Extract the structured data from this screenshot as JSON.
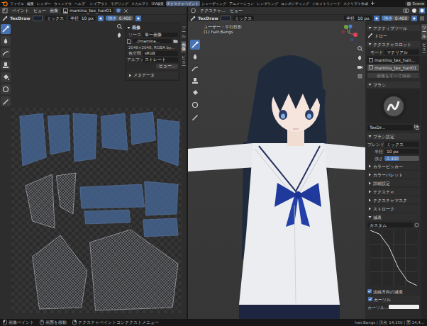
{
  "topbar": {
    "menus": [
      "ファイル",
      "編集",
      "レンダー",
      "ウィンドウ",
      "ヘルプ"
    ],
    "workspaces": [
      {
        "label": "レイアウト",
        "selected": false
      },
      {
        "label": "モデリング",
        "selected": false
      },
      {
        "label": "スカルプト",
        "selected": false
      },
      {
        "label": "UV編集",
        "selected": false
      },
      {
        "label": "テクスチャペイント",
        "selected": true
      },
      {
        "label": "シェーディング",
        "selected": false
      },
      {
        "label": "アニメーション",
        "selected": false
      },
      {
        "label": "レンダリング",
        "selected": false
      },
      {
        "label": "コンポジティング",
        "selected": false
      },
      {
        "label": "ジオメトリノード",
        "selected": false
      },
      {
        "label": "スクリプト作成",
        "selected": false
      }
    ],
    "scene": "Scene"
  },
  "image_editor": {
    "header": {
      "mode": "ペイント",
      "menus": [
        "ビュー",
        "画像"
      ],
      "image": "mamina_tex_hair01"
    },
    "tool_settings": {
      "brush": "TexDraw",
      "brush_color": "#1b2230",
      "blend": "ミックス",
      "radius_label": "半径",
      "radius": "10 px",
      "strength_label": "強さ",
      "strength": "0.400",
      "strength_level": 0.4
    },
    "panel": {
      "title": "画像",
      "expanded": true,
      "source_label": "ソース",
      "source": "単一画像",
      "path": "..//mamina...",
      "info": "2048×2048, RGBA by...",
      "colorspace_label": "色空間",
      "colorspace": "sRGB",
      "alpha_label": "アルファ",
      "alpha": "ストレート",
      "view_button": "ビュー...",
      "metadata": "メタデータ",
      "metadata_expanded": false
    },
    "tabs": [
      {
        "label": "ツール",
        "selected": false
      },
      {
        "label": "画像",
        "selected": true
      },
      {
        "label": "ビュー",
        "selected": false
      }
    ]
  },
  "viewport": {
    "header": {
      "mode": "テクスチャ...",
      "menus": [
        "ビュー"
      ]
    },
    "tool_settings": {
      "brush": "TexDraw",
      "brush_color": "#1b2230",
      "blend": "ミックス",
      "radius_label": "半径",
      "radius": "10 px",
      "strength_label": "強さ",
      "strength": "0.400",
      "strength_level": 0.4
    },
    "overlay": {
      "view": "ユーザー・平行投影",
      "object": "(1) hair.Bangs"
    }
  },
  "properties": {
    "active_tool": {
      "title": "アクティブツール",
      "tool": "ドロー"
    },
    "texture_slots": {
      "title": "テクスチャスロット",
      "mode_label": "モード",
      "mode": "マテリアル",
      "slots": [
        {
          "label": "mamina_tex_hair...",
          "selected": false
        },
        {
          "label": "mamina_tex_hair01",
          "selected": true
        }
      ],
      "save_button": "画像をすべて保存"
    },
    "brush": {
      "title": "ブラシ",
      "name": "TexDr..."
    },
    "brush_settings": {
      "title": "ブラシ設定",
      "blend_label": "ブレンド",
      "blend": "ミックス",
      "radius_label": "半径",
      "radius": "10 px",
      "strength_label": "強さ",
      "strength": "0.400",
      "strength_level": 0.4
    },
    "sections": [
      {
        "label": "カラーピッカー",
        "expanded": false
      },
      {
        "label": "カラーパレット",
        "expanded": false
      },
      {
        "label": "詳細設定",
        "expanded": false
      },
      {
        "label": "テクスチャ",
        "expanded": false
      },
      {
        "label": "テクスチャマスク",
        "expanded": false
      },
      {
        "label": "ストローク",
        "expanded": false
      }
    ],
    "falloff": {
      "title": "減衰",
      "expanded": true,
      "preset": "カスタム",
      "curve": [
        [
          0,
          1
        ],
        [
          0.2,
          0.93
        ],
        [
          0.4,
          0.7
        ],
        [
          0.6,
          0.32
        ],
        [
          0.8,
          0.08
        ],
        [
          1,
          0
        ]
      ],
      "normal": {
        "label": "法線方向の減衰",
        "checked": true
      }
    },
    "cursor": {
      "label": "カーソル",
      "checked": true,
      "color_label": "カーソル..."
    }
  },
  "right_tabs": [
    {
      "label": "ツール",
      "selected": true
    },
    {
      "label": "ビュー",
      "selected": false
    }
  ],
  "status_bar": {
    "items": [
      "画像ペイント",
      "画面を移動",
      "テクスチャペイントコンテクストメニュー"
    ],
    "info": "hair.Bangs | 頂点 14,150 | 面 14,4..."
  }
}
